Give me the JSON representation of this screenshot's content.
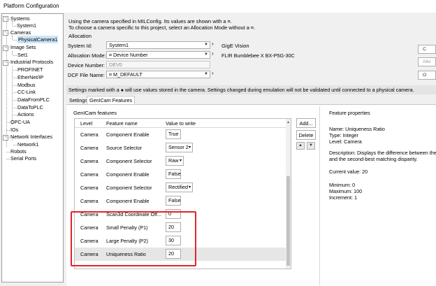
{
  "window": {
    "title": "Platform Configuration"
  },
  "tree": [
    {
      "label": "Systems",
      "exp": "−"
    },
    {
      "label": "System1"
    },
    {
      "label": "Cameras",
      "exp": "−"
    },
    {
      "label": "PhysicalCamera1",
      "selected": true
    },
    {
      "label": "Image Sets",
      "exp": "−"
    },
    {
      "label": "Set1"
    },
    {
      "label": "Industrial Protocols",
      "exp": "−"
    },
    {
      "label": "PROFINET"
    },
    {
      "label": "EtherNet/IP"
    },
    {
      "label": "Modbus"
    },
    {
      "label": "CC-Link"
    },
    {
      "label": "DataFromPLC"
    },
    {
      "label": "DataToPLC"
    },
    {
      "label": "Actions"
    },
    {
      "label": "OPC-UA"
    },
    {
      "label": "IOs"
    },
    {
      "label": "Network Interfaces",
      "exp": "−"
    },
    {
      "label": "Network1"
    },
    {
      "label": "Robots"
    },
    {
      "label": "Serial Ports"
    }
  ],
  "info": {
    "line1": "Using the camera specified in MILConfig. Its values are shown with a ¤.",
    "line2": "To choose a camera specific to this project, select an Allocation Mode without a ¤."
  },
  "allocation": {
    "group_label": "Allocation",
    "system_id_label": "System Id:",
    "system_id_value": "System1",
    "mode_label": "Allocation Mode:",
    "mode_value": "¤ Device Number",
    "device_label": "Device Number:",
    "device_value": "DEV0",
    "dcf_label": "DCF File Name:",
    "dcf_value": "¤ M_DEFAULT",
    "interface_type": "GigE Vision",
    "camera_model": "FLIR Bumblebee X BX-P5G-30C",
    "side_buttons": [
      "C",
      "Allo",
      "O"
    ]
  },
  "notice": "Settings marked with a ● will use values stored in the camera.  Settings changed during emulation will not be validated until connected to a physical camera.",
  "tabs": [
    "Settings",
    "GenICam Features"
  ],
  "features": {
    "group_label": "GenICam features",
    "columns": [
      "Level",
      "Feature name",
      "Value to write"
    ],
    "rows": [
      {
        "level": "Camera",
        "name": "Component Enable",
        "value": "True",
        "type": "text"
      },
      {
        "level": "Camera",
        "name": "Source Selector",
        "value": "Sensor 2",
        "type": "combo"
      },
      {
        "level": "Camera",
        "name": "Component Selector",
        "value": "Raw",
        "type": "combo"
      },
      {
        "level": "Camera",
        "name": "Component Enable",
        "value": "False",
        "type": "text"
      },
      {
        "level": "Camera",
        "name": "Component Selector",
        "value": "Rectified",
        "type": "combo"
      },
      {
        "level": "Camera",
        "name": "Component Enable",
        "value": "False",
        "type": "text"
      },
      {
        "level": "Camera",
        "name": "Scan3d Coordinate Off...",
        "value": "0",
        "type": "text"
      },
      {
        "level": "Camera",
        "name": "Small Penalty (P1)",
        "value": "20",
        "type": "text"
      },
      {
        "level": "Camera",
        "name": "Large Penalty (P2)",
        "value": "30",
        "type": "text"
      },
      {
        "level": "Camera",
        "name": "Uniqueness Ratio",
        "value": "20",
        "type": "text",
        "selected": true
      }
    ],
    "add_label": "Add...",
    "delete_label": "Delete"
  },
  "properties": {
    "title": "Feature properties",
    "name": "Name: Uniqueness Ratio",
    "type": "Type: Integer",
    "level": "Level: Camera",
    "description_1": "Description: Displays the difference between the be",
    "description_2": "and the second-best matching disparity.",
    "current": "Current value: 20",
    "minimum": "Minimum: 0",
    "maximum": "Maximum: 100",
    "increment": "Increment: 1"
  },
  "colors": {
    "selection": "#cce4f7",
    "highlight": "#e0242b",
    "grid_selected": "#e6e6e6"
  }
}
